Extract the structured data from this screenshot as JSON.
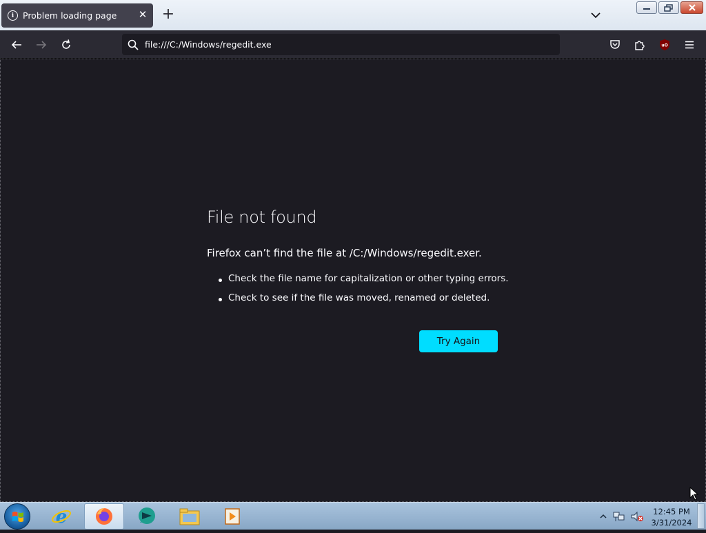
{
  "browser": {
    "tab": {
      "title": "Problem loading page",
      "icon": "info-icon"
    },
    "url": "file:///C:/Windows/regedit.exe",
    "nav_icons": [
      "back-icon",
      "forward-icon",
      "reload-icon",
      "search-icon",
      "pocket-icon",
      "extensions-icon",
      "ublock-icon",
      "menu-icon"
    ]
  },
  "error_page": {
    "title": "File not found",
    "description": "Firefox can’t find the file at /C:/Windows/regedit.exer.",
    "suggestions": [
      "Check the file name for capitalization or other typing errors.",
      "Check to see if the file was moved, renamed or deleted."
    ],
    "button_label": "Try Again"
  },
  "taskbar": {
    "apps": [
      "internet-explorer-icon",
      "firefox-icon",
      "chat-app-icon",
      "file-explorer-icon",
      "media-player-icon"
    ],
    "time": "12:45 PM",
    "date": "3/31/2024"
  },
  "colors": {
    "content_bg": "#1c1b22",
    "toolbar_bg": "#2b2a33",
    "tab_bg": "#42414d",
    "accent": "#00ddff",
    "text": "#fbfbfe"
  }
}
